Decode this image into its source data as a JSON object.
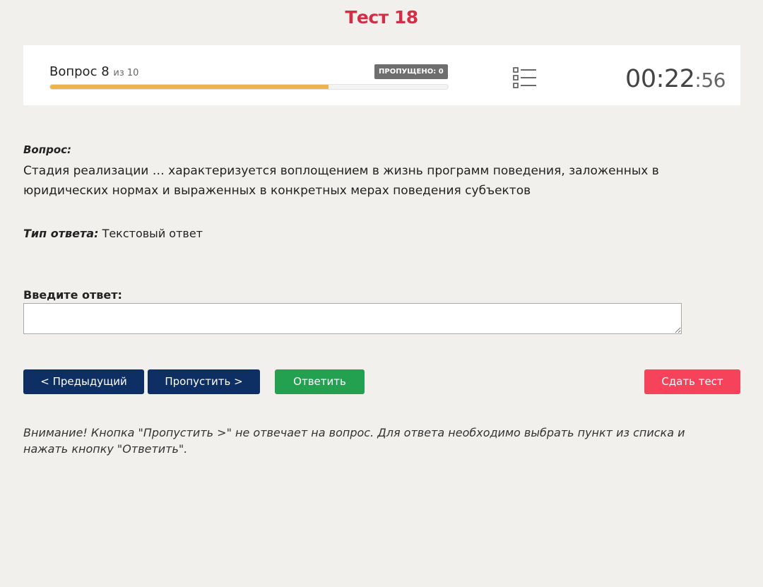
{
  "title": "Тест 18",
  "status": {
    "question_word": "Вопрос",
    "current": "8",
    "of_text": "из 10",
    "skipped_badge": "ПРОПУЩЕНО: 0",
    "progress_fraction": 0.7,
    "timer_main": "00:22",
    "timer_colon": ":",
    "timer_seconds": "56",
    "list_icon": "list-icon"
  },
  "question": {
    "label": "Вопрос:",
    "text": "Стадия реализации … характеризуется воплощением в жизнь программ поведения, заложенных в юридических нормах и выраженных в конкретных мерах поведения субъектов"
  },
  "answer_type": {
    "label": "Тип ответа:",
    "value": "Текстовый ответ"
  },
  "answer": {
    "label": "Введите ответ:",
    "value": ""
  },
  "buttons": {
    "prev": "< Предыдущий",
    "skip": "Пропустить >",
    "answer": "Ответить",
    "finish": "Сдать тест"
  },
  "notice": "Внимание! Кнопка \"Пропустить >\" не отвечает на вопрос. Для ответа необходимо выбрать пункт из списка и нажать кнопку \"Ответить\".",
  "colors": {
    "title": "#d42e47",
    "nav_button": "#0e2f63",
    "answer_button": "#24a150",
    "finish_button": "#f4435a",
    "progress": "#eab44a"
  }
}
